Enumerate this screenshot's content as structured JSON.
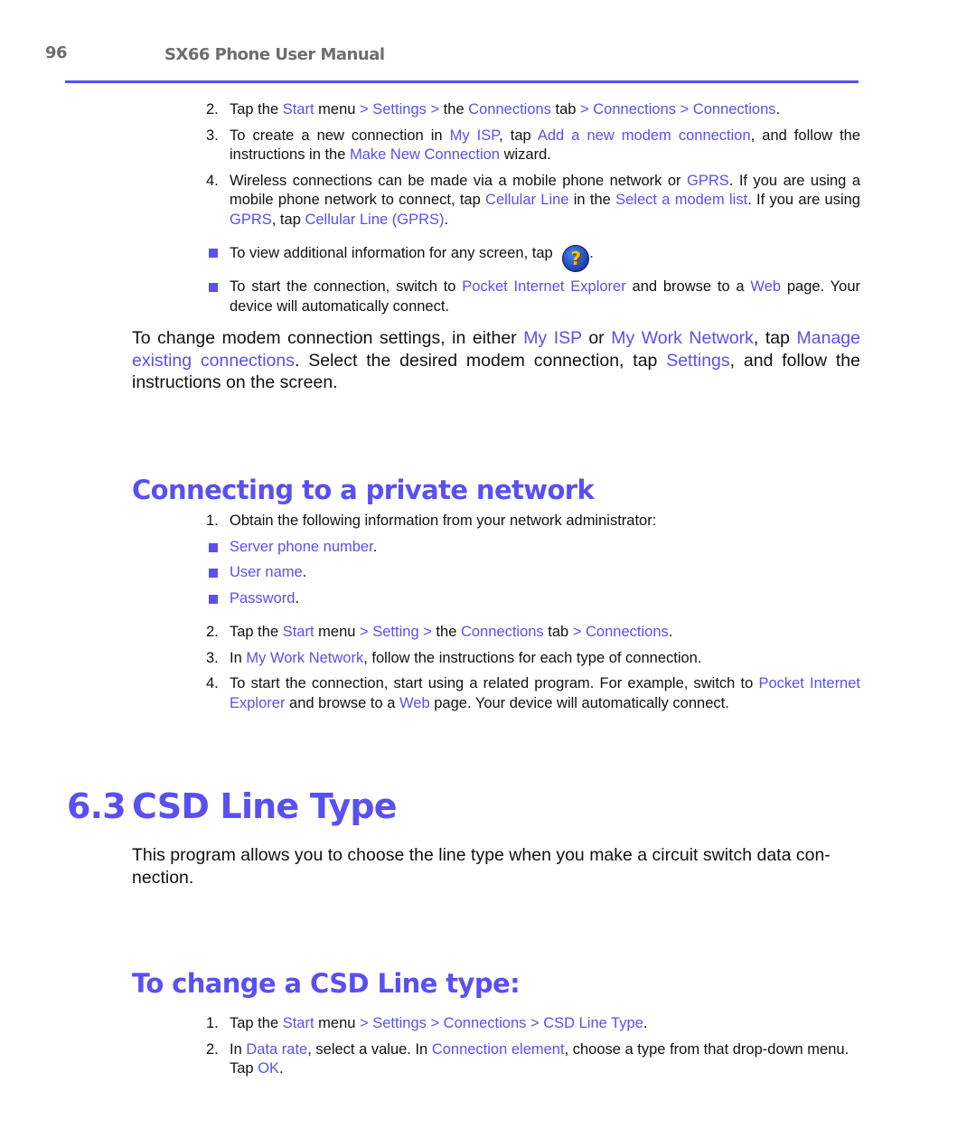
{
  "header": {
    "page_number": "96",
    "manual_title": "SX66 Phone User Manual"
  },
  "colors": {
    "accent": "#5a4ff3",
    "header_gray": "#6e6e6e",
    "body_text": "#111111"
  },
  "section_isp": {
    "steps": [
      {
        "num": "2.",
        "parts": [
          "Tap the ",
          "Start",
          " menu ",
          "> Settings >",
          " the ",
          "Connections",
          " tab ",
          "> Connections > Connections",
          "."
        ]
      },
      {
        "num": "3.",
        "parts": [
          "To create a new connection in ",
          "My ISP",
          ", tap ",
          "Add a new modem connection",
          ", and follow the instructions in the ",
          "Make New Connection",
          " wizard."
        ]
      },
      {
        "num": "4.",
        "parts": [
          "Wireless connections can be made via a mobile phone network or ",
          "GPRS",
          ". If you are using a mobile phone network to connect, tap ",
          "Cellular Line",
          " in the ",
          "Select a modem list",
          ". If you are using ",
          "GPRS",
          ", tap ",
          "Cellular Line (GPRS)",
          "."
        ]
      }
    ],
    "bullets": [
      {
        "parts": [
          "To view additional information for any screen, tap ",
          "."
        ],
        "icon": "help-icon",
        "icon_glyph": "?"
      },
      {
        "parts": [
          "To start the connection, switch to ",
          "Pocket Internet Explorer",
          " and browse to a ",
          "Web",
          " page. Your device will automatically connect."
        ]
      }
    ],
    "paragraph": {
      "parts": [
        "To change modem connection settings, in either ",
        "My ISP",
        " or ",
        "My Work Network",
        ", tap ",
        "Manage existing connections",
        ". Select the desired modem connection, tap ",
        "Settings",
        ", and follow the instructions on the screen."
      ]
    }
  },
  "section_private": {
    "heading": "Connecting to a private network",
    "step1": {
      "num": "1.",
      "text": "Obtain the following information from your network administrator:"
    },
    "info_items": [
      {
        "label": "Server phone number",
        "suffix": "."
      },
      {
        "label": "User name",
        "suffix": "."
      },
      {
        "label": "Password",
        "suffix": "."
      }
    ],
    "steps": [
      {
        "num": "2.",
        "parts": [
          "Tap the ",
          "Start",
          " menu ",
          "> Setting >",
          " the ",
          "Connections",
          " tab ",
          "> Connections",
          "."
        ]
      },
      {
        "num": "3.",
        "parts": [
          "In ",
          "My Work Network",
          ", follow the instructions for each type of connection."
        ]
      },
      {
        "num": "4.",
        "parts": [
          "To start the connection, start using a related program. For example, switch to ",
          "Pocket Internet Explorer",
          " and browse to a ",
          "Web",
          " page. Your device will automatically connect."
        ]
      }
    ]
  },
  "section_csd": {
    "number": "6.3",
    "title": "CSD Line Type",
    "intro": "This program allows you to choose the line type when you make a circuit switch data con-nection.",
    "subheading": "To change a CSD Line type:",
    "steps": [
      {
        "num": "1.",
        "parts": [
          "Tap the ",
          "Start",
          " menu ",
          "> Settings > Connections > CSD Line Type",
          "."
        ]
      },
      {
        "num": "2.",
        "parts": [
          "In ",
          "Data rate",
          ", select a value. In ",
          "Connection element",
          ", choose a type from that drop-down menu. Tap ",
          "OK",
          "."
        ]
      }
    ]
  }
}
